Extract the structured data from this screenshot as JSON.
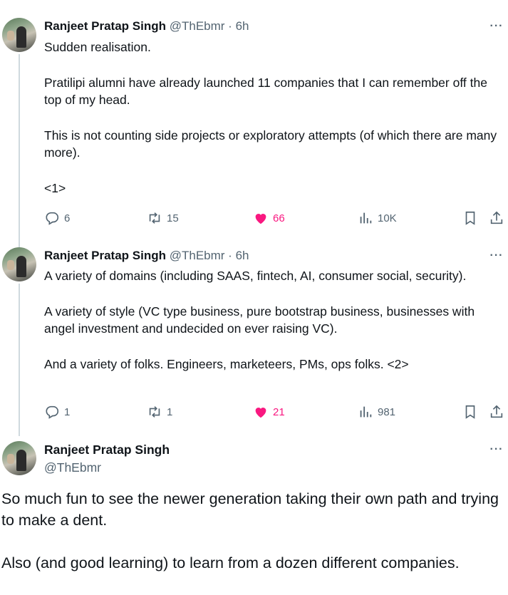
{
  "tweets": [
    {
      "name": "Ranjeet Pratap Singh",
      "handle": "@ThEbmr",
      "sep": "·",
      "time": "6h",
      "paragraphs": [
        "Sudden realisation.",
        "Pratilipi alumni have already launched 11 companies that I can remember off the top of my head.",
        "This is not counting side projects or exploratory attempts (of which there are many more).",
        "<1>"
      ],
      "replies": "6",
      "retweets": "15",
      "likes": "66",
      "views": "10K"
    },
    {
      "name": "Ranjeet Pratap Singh",
      "handle": "@ThEbmr",
      "sep": "·",
      "time": "6h",
      "paragraphs": [
        "A variety of domains (including SAAS, fintech, AI, consumer social, security).",
        "A variety of style (VC type business, pure bootstrap business, businesses with angel investment and undecided on ever raising VC).",
        "And a variety of folks. Engineers, marketeers, PMs, ops folks. <2>"
      ],
      "replies": "1",
      "retweets": "1",
      "likes": "21",
      "views": "981"
    }
  ],
  "main_tweet": {
    "name": "Ranjeet Pratap Singh",
    "handle": "@ThEbmr",
    "paragraphs": [
      "So much fun to see the newer generation taking their own path and trying to make a dent.",
      "Also  (and good learning) to learn from a dozen different companies."
    ]
  },
  "more_label": "···",
  "colors": {
    "like": "#f91880",
    "muted": "#536471",
    "text": "#0f1419",
    "thread_line": "#cfd9de"
  },
  "icons": [
    "reply-icon",
    "retweet-icon",
    "like-icon",
    "views-icon",
    "bookmark-icon",
    "share-icon",
    "more-icon"
  ]
}
